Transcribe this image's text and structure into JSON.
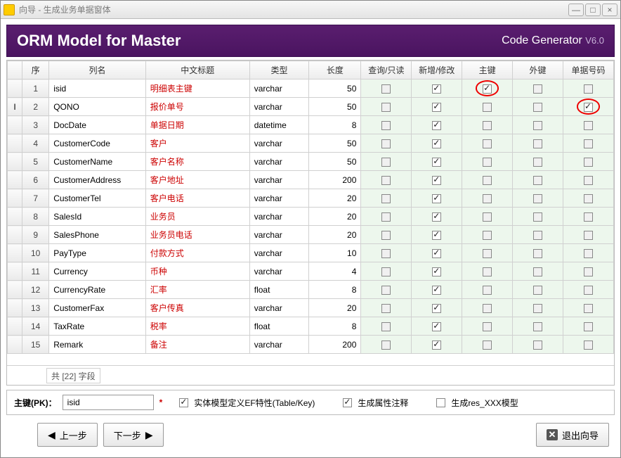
{
  "window": {
    "title": "向导 - 生成业务单据窗体"
  },
  "banner": {
    "title": "ORM Model for Master",
    "product": "Code Generator",
    "version": "V6.0"
  },
  "columns": {
    "seq": "序",
    "name": "列名",
    "cn": "中文标题",
    "type": "类型",
    "len": "长度",
    "c1": "查询/只读",
    "c2": "新增/修改",
    "c3": "主键",
    "c4": "外键",
    "c5": "单据号码"
  },
  "rows": [
    {
      "seq": 1,
      "name": "isid",
      "cn": "明细表主键",
      "type": "varchar",
      "len": 50,
      "c1": false,
      "c2": true,
      "c3": true,
      "c4": false,
      "c5": false,
      "circle": "c3",
      "ind": ""
    },
    {
      "seq": 2,
      "name": "QONO",
      "cn": "报价单号",
      "type": "varchar",
      "len": 50,
      "c1": false,
      "c2": true,
      "c3": false,
      "c4": false,
      "c5": true,
      "circle": "c5",
      "ind": "I"
    },
    {
      "seq": 3,
      "name": "DocDate",
      "cn": "单据日期",
      "type": "datetime",
      "len": 8,
      "c1": false,
      "c2": true,
      "c3": false,
      "c4": false,
      "c5": false
    },
    {
      "seq": 4,
      "name": "CustomerCode",
      "cn": "客户",
      "type": "varchar",
      "len": 50,
      "c1": false,
      "c2": true,
      "c3": false,
      "c4": false,
      "c5": false
    },
    {
      "seq": 5,
      "name": "CustomerName",
      "cn": "客户名称",
      "type": "varchar",
      "len": 50,
      "c1": false,
      "c2": true,
      "c3": false,
      "c4": false,
      "c5": false
    },
    {
      "seq": 6,
      "name": "CustomerAddress",
      "cn": "客户地址",
      "type": "varchar",
      "len": 200,
      "c1": false,
      "c2": true,
      "c3": false,
      "c4": false,
      "c5": false
    },
    {
      "seq": 7,
      "name": "CustomerTel",
      "cn": "客户电话",
      "type": "varchar",
      "len": 20,
      "c1": false,
      "c2": true,
      "c3": false,
      "c4": false,
      "c5": false
    },
    {
      "seq": 8,
      "name": "SalesId",
      "cn": "业务员",
      "type": "varchar",
      "len": 20,
      "c1": false,
      "c2": true,
      "c3": false,
      "c4": false,
      "c5": false
    },
    {
      "seq": 9,
      "name": "SalesPhone",
      "cn": "业务员电话",
      "type": "varchar",
      "len": 20,
      "c1": false,
      "c2": true,
      "c3": false,
      "c4": false,
      "c5": false
    },
    {
      "seq": 10,
      "name": "PayType",
      "cn": "付款方式",
      "type": "varchar",
      "len": 10,
      "c1": false,
      "c2": true,
      "c3": false,
      "c4": false,
      "c5": false
    },
    {
      "seq": 11,
      "name": "Currency",
      "cn": "币种",
      "type": "varchar",
      "len": 4,
      "c1": false,
      "c2": true,
      "c3": false,
      "c4": false,
      "c5": false
    },
    {
      "seq": 12,
      "name": "CurrencyRate",
      "cn": "汇率",
      "type": "float",
      "len": 8,
      "c1": false,
      "c2": true,
      "c3": false,
      "c4": false,
      "c5": false
    },
    {
      "seq": 13,
      "name": "CustomerFax",
      "cn": "客户传真",
      "type": "varchar",
      "len": 20,
      "c1": false,
      "c2": true,
      "c3": false,
      "c4": false,
      "c5": false
    },
    {
      "seq": 14,
      "name": "TaxRate",
      "cn": "税率",
      "type": "float",
      "len": 8,
      "c1": false,
      "c2": true,
      "c3": false,
      "c4": false,
      "c5": false
    },
    {
      "seq": 15,
      "name": "Remark",
      "cn": "备注",
      "type": "varchar",
      "len": 200,
      "c1": false,
      "c2": true,
      "c3": false,
      "c4": false,
      "c5": false
    }
  ],
  "footer": {
    "count_text": "共 [22] 字段"
  },
  "pk": {
    "label": "主键(PK)：",
    "value": "isid",
    "opt1": "实体模型定义EF特性(Table/Key)",
    "opt1_checked": true,
    "opt2": "生成属性注释",
    "opt2_checked": true,
    "opt3": "生成res_XXX模型",
    "opt3_checked": false
  },
  "buttons": {
    "prev": "上一步",
    "next": "下一步",
    "exit": "退出向导"
  }
}
